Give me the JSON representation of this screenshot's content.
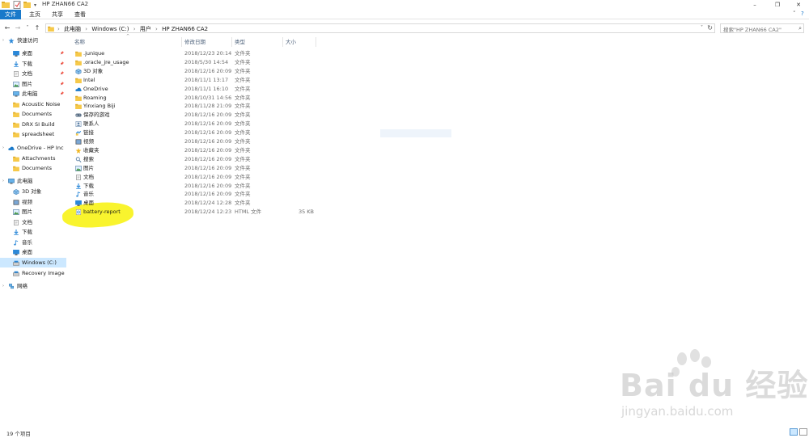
{
  "window": {
    "title": "HP ZHAN66 CA2",
    "minimize": "–",
    "maximize": "❐",
    "close": "✕"
  },
  "ribbon": {
    "tabs": [
      {
        "label": "文件"
      },
      {
        "label": "主页"
      },
      {
        "label": "共享"
      },
      {
        "label": "查看"
      }
    ],
    "help": "?"
  },
  "address": {
    "back": "←",
    "forward": "→",
    "recent": "˅",
    "up": "↑",
    "crumbs": [
      "此电脑",
      "Windows (C:)",
      "用户",
      "HP ZHAN66 CA2"
    ],
    "separator": "›",
    "dropdown": "˅",
    "refresh": "↻"
  },
  "search": {
    "placeholder": "搜索\"HP ZHAN66 CA2\""
  },
  "sidebar": {
    "items": [
      {
        "label": "快速访问",
        "icon": "star-icon"
      },
      {
        "label": "桌面",
        "icon": "desktop-icon"
      },
      {
        "label": "下载",
        "icon": "download-icon"
      },
      {
        "label": "文档",
        "icon": "document-icon"
      },
      {
        "label": "图片",
        "icon": "picture-icon"
      },
      {
        "label": "此电脑",
        "icon": "computer-icon"
      },
      {
        "label": "Acoustic Noise",
        "icon": "folder-icon"
      },
      {
        "label": "Documents",
        "icon": "folder-icon"
      },
      {
        "label": "DRX SI Build",
        "icon": "folder-icon"
      },
      {
        "label": "spreadsheet",
        "icon": "folder-icon"
      },
      {
        "label": "OneDrive - HP Inc",
        "icon": "onedrive-icon"
      },
      {
        "label": "Attachments",
        "icon": "folder-icon"
      },
      {
        "label": "Documents",
        "icon": "folder-icon"
      },
      {
        "label": "此电脑",
        "icon": "computer-icon"
      },
      {
        "label": "3D 对象",
        "icon": "3d-objects-icon"
      },
      {
        "label": "视频",
        "icon": "video-icon"
      },
      {
        "label": "图片",
        "icon": "picture-icon"
      },
      {
        "label": "文档",
        "icon": "document-icon"
      },
      {
        "label": "下载",
        "icon": "download-icon"
      },
      {
        "label": "音乐",
        "icon": "music-icon"
      },
      {
        "label": "桌面",
        "icon": "desktop-icon"
      },
      {
        "label": "Windows (C:)",
        "icon": "drive-icon"
      },
      {
        "label": "Recovery Image (",
        "icon": "drive-icon"
      },
      {
        "label": "网络",
        "icon": "network-icon"
      }
    ]
  },
  "columns": {
    "name": "名称",
    "date": "修改日期",
    "type": "类型",
    "size": "大小"
  },
  "files": [
    {
      "name": ".junique",
      "date": "2018/12/23 20:14",
      "type": "文件夹",
      "size": "",
      "icon": "folder-icon"
    },
    {
      "name": ".oracle_jre_usage",
      "date": "2018/5/30 14:54",
      "type": "文件夹",
      "size": "",
      "icon": "folder-icon"
    },
    {
      "name": "3D 对象",
      "date": "2018/12/16 20:09",
      "type": "文件夹",
      "size": "",
      "icon": "3d-objects-icon"
    },
    {
      "name": "Intel",
      "date": "2018/11/1 13:17",
      "type": "文件夹",
      "size": "",
      "icon": "folder-icon"
    },
    {
      "name": "OneDrive",
      "date": "2018/11/1 16:10",
      "type": "文件夹",
      "size": "",
      "icon": "onedrive-icon"
    },
    {
      "name": "Roaming",
      "date": "2018/10/31 14:56",
      "type": "文件夹",
      "size": "",
      "icon": "folder-icon"
    },
    {
      "name": "Yinxiang Biji",
      "date": "2018/11/28 21:09",
      "type": "文件夹",
      "size": "",
      "icon": "folder-icon"
    },
    {
      "name": "保存的游戏",
      "date": "2018/12/16 20:09",
      "type": "文件夹",
      "size": "",
      "icon": "saved-games-icon"
    },
    {
      "name": "联系人",
      "date": "2018/12/16 20:09",
      "type": "文件夹",
      "size": "",
      "icon": "contacts-icon"
    },
    {
      "name": "链接",
      "date": "2018/12/16 20:09",
      "type": "文件夹",
      "size": "",
      "icon": "links-icon"
    },
    {
      "name": "视频",
      "date": "2018/12/16 20:09",
      "type": "文件夹",
      "size": "",
      "icon": "video-icon"
    },
    {
      "name": "收藏夹",
      "date": "2018/12/16 20:09",
      "type": "文件夹",
      "size": "",
      "icon": "favorites-icon"
    },
    {
      "name": "搜索",
      "date": "2018/12/16 20:09",
      "type": "文件夹",
      "size": "",
      "icon": "search-folder-icon"
    },
    {
      "name": "图片",
      "date": "2018/12/16 20:09",
      "type": "文件夹",
      "size": "",
      "icon": "picture-icon"
    },
    {
      "name": "文档",
      "date": "2018/12/16 20:09",
      "type": "文件夹",
      "size": "",
      "icon": "document-icon"
    },
    {
      "name": "下载",
      "date": "2018/12/16 20:09",
      "type": "文件夹",
      "size": "",
      "icon": "download-icon"
    },
    {
      "name": "音乐",
      "date": "2018/12/16 20:09",
      "type": "文件夹",
      "size": "",
      "icon": "music-icon"
    },
    {
      "name": "桌面",
      "date": "2018/12/24 12:28",
      "type": "文件夹",
      "size": "",
      "icon": "desktop-icon"
    },
    {
      "name": "battery-report",
      "date": "2018/12/24 12:23",
      "type": "HTML 文件",
      "size": "35 KB",
      "icon": "html-file-icon"
    }
  ],
  "status": {
    "item_count": "19 个项目"
  },
  "watermark": {
    "brand": "Bai du 经验",
    "url": "jingyan.baidu.com"
  },
  "colors": {
    "accent": "#1979ca",
    "selection": "#cce8ff",
    "folder": "#f6c94a",
    "highlight": "#f9f31c"
  }
}
